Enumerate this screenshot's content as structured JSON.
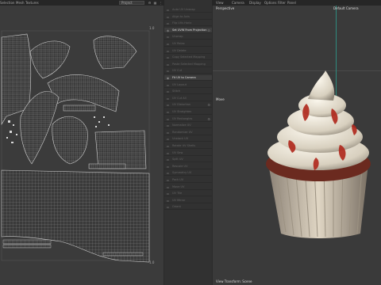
{
  "topbar": {
    "items": [
      "Selection",
      "Mesh",
      "Textures"
    ],
    "projection_select": "Project",
    "viewport_menu": [
      "View",
      "Camera",
      "Display",
      "Options",
      "Filter",
      "Panel"
    ]
  },
  "uv_editor": {
    "corner_tr": "1.0",
    "corner_br": "1.0"
  },
  "menu": {
    "items": [
      {
        "label": "Auto UV Unwrap",
        "enabled": false,
        "icon": "grid-icon"
      },
      {
        "label": "Align to Axis",
        "enabled": false,
        "icon": "axis-icon"
      },
      {
        "label": "Flip UVs Horiz",
        "enabled": false,
        "icon": "flip-icon"
      },
      {
        "label": "Set UVW From Projection",
        "enabled": true,
        "icon": "projection-icon",
        "gear": true
      },
      {
        "label": "Unwrap",
        "enabled": false,
        "icon": "unwrap-icon"
      },
      {
        "label": "UV Relax",
        "enabled": false,
        "icon": "relax-icon"
      },
      {
        "label": "UV Delete",
        "enabled": false,
        "icon": "delete-icon"
      },
      {
        "label": "Copy Selected Mapping",
        "enabled": false,
        "icon": "copy-icon"
      },
      {
        "label": "Paste Selected Mapping",
        "enabled": false,
        "icon": "paste-icon"
      },
      {
        "label": "UV Cut",
        "enabled": false,
        "icon": "cut-icon"
      },
      {
        "label": "Fit UV to Camera",
        "enabled": true,
        "icon": "camera-icon"
      },
      {
        "label": "UV Layout",
        "enabled": false,
        "icon": "layout-icon"
      },
      {
        "label": "Stitch",
        "enabled": false,
        "icon": "stitch-icon"
      },
      {
        "label": "UV Cut All",
        "enabled": false,
        "icon": "cut-icon"
      },
      {
        "label": "UV Distortion",
        "enabled": false,
        "icon": "distortion-icon",
        "gear": true
      },
      {
        "label": "UV Straighten",
        "enabled": false,
        "icon": "straighten-icon"
      },
      {
        "label": "UV Rectangles",
        "enabled": false,
        "icon": "rect-icon",
        "gear": true
      },
      {
        "label": "Normalize UV",
        "enabled": false,
        "icon": "normalize-icon"
      },
      {
        "label": "Randomize UV",
        "enabled": false,
        "icon": "random-icon"
      },
      {
        "label": "Unstack UV",
        "enabled": false,
        "icon": "unstack-icon"
      },
      {
        "label": "Rotate UV Shells",
        "enabled": false,
        "icon": "rotate-icon"
      },
      {
        "label": "UV Sew",
        "enabled": false,
        "icon": "sew-icon"
      },
      {
        "label": "Split UV",
        "enabled": false,
        "icon": "split-icon"
      },
      {
        "label": "Rescale UV",
        "enabled": false,
        "icon": "scale-icon"
      },
      {
        "label": "Symmetry UV",
        "enabled": false,
        "icon": "symmetry-icon"
      },
      {
        "label": "Pack UV",
        "enabled": false,
        "icon": "pack-icon"
      },
      {
        "label": "Move UV",
        "enabled": false,
        "icon": "move-icon"
      },
      {
        "label": "UV Tile",
        "enabled": false,
        "icon": "tile-icon"
      },
      {
        "label": "UV Mirror",
        "enabled": false,
        "icon": "mirror-icon"
      },
      {
        "label": "Orient",
        "enabled": false,
        "icon": "orient-icon"
      }
    ]
  },
  "viewport": {
    "view_label": "Perspective",
    "camera_label": "Default Camera",
    "move_label": "Move",
    "bottom_label": "View Transform: Scene"
  },
  "colors": {
    "accent_teal": "#2e8b7f",
    "frosting": "#e9e3d6",
    "sauce": "#b0271b",
    "liner": "#cfc4b2",
    "cake": "#6b2a1f"
  }
}
